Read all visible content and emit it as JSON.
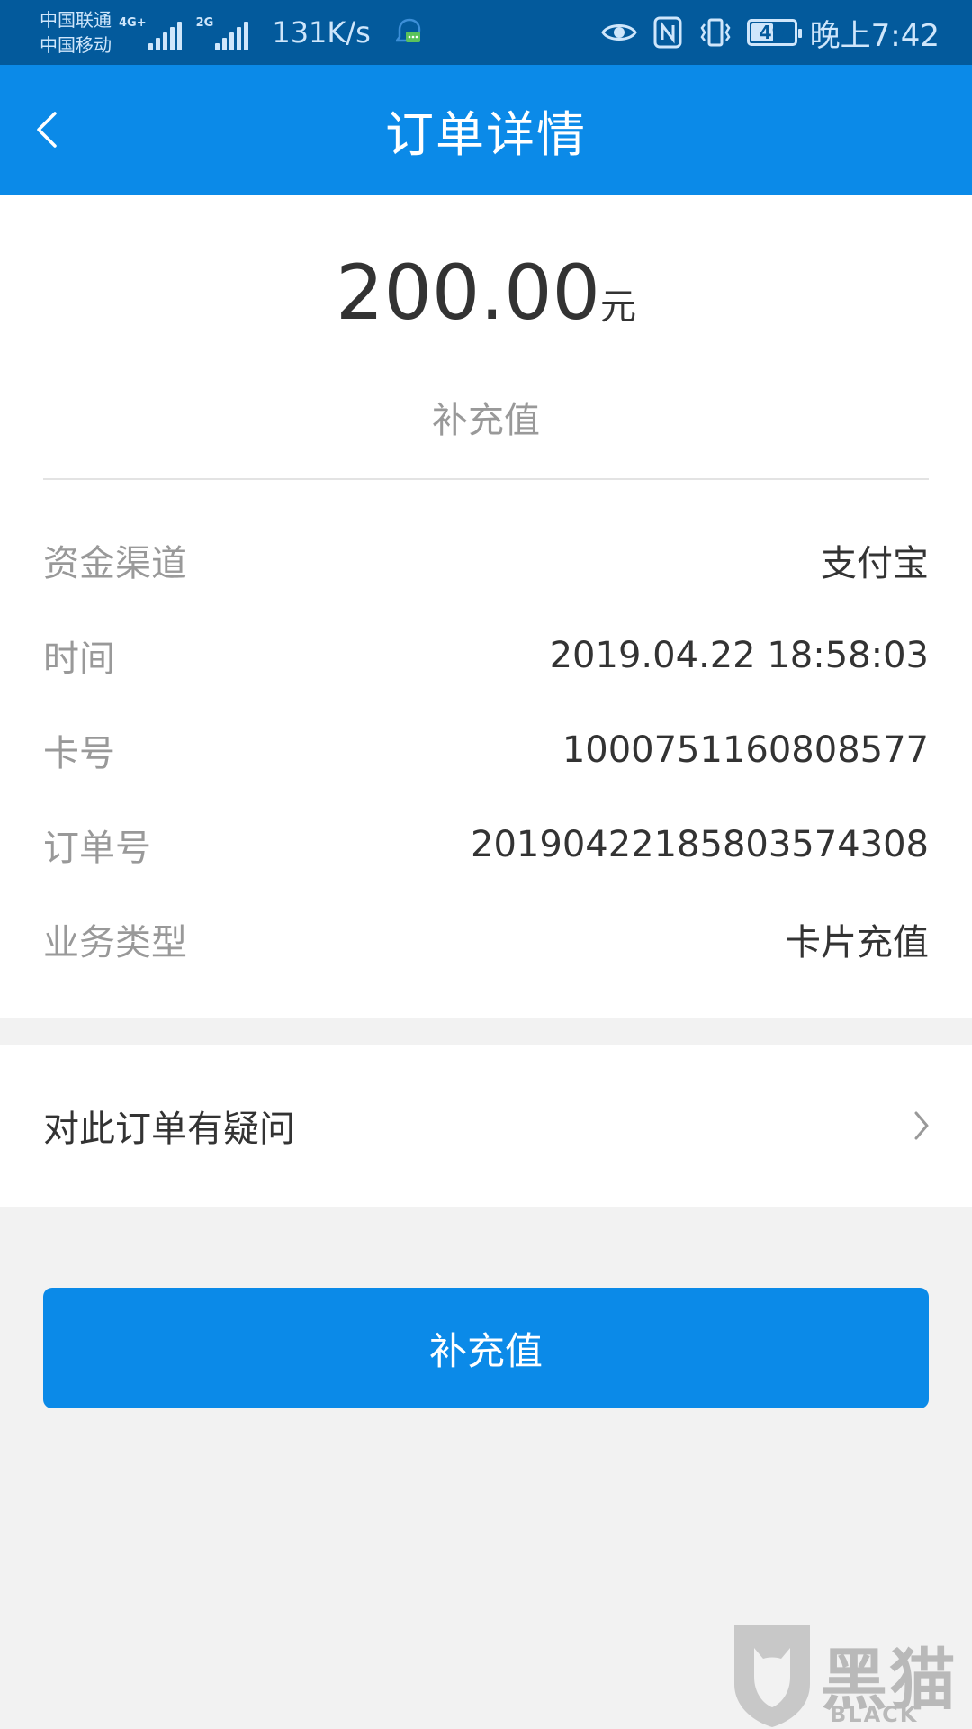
{
  "status_bar": {
    "carrier_1": "中国联通",
    "carrier_2": "中国移动",
    "net_1": "4G+",
    "net_2": "2G",
    "net_speed": "131K/s",
    "battery": "49",
    "time": "晚上7:42"
  },
  "header": {
    "title": "订单详情"
  },
  "summary": {
    "amount": "200.00",
    "unit": "元",
    "subtitle": "补充值"
  },
  "details": [
    {
      "label": "资金渠道",
      "value": "支付宝"
    },
    {
      "label": "时间",
      "value": "2019.04.22 18:58:03"
    },
    {
      "label": "卡号",
      "value": "1000751160808577"
    },
    {
      "label": "订单号",
      "value": "20190422185803574308"
    },
    {
      "label": "业务类型",
      "value": "卡片充值"
    }
  ],
  "question": {
    "label": "对此订单有疑问"
  },
  "action": {
    "label": "补充值"
  },
  "watermark": {
    "text_cn": "黑猫",
    "text_en": "BLACK CAT"
  },
  "colors": {
    "status_bar": "#035a9c",
    "header": "#0b8ae8",
    "button": "#0b8ae8",
    "background": "#f2f2f2"
  }
}
